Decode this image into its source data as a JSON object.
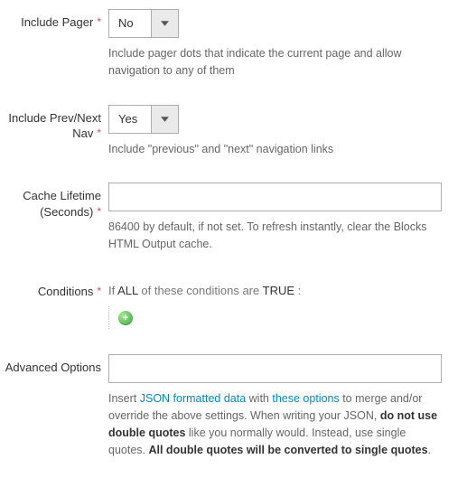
{
  "fields": {
    "includePager": {
      "label": "Include Pager",
      "value": "No",
      "note": "Include pager dots that indicate the current page and allow navigation to any of them"
    },
    "includePrevNext": {
      "label": "Include Prev/Next Nav",
      "value": "Yes",
      "note": "Include \"previous\" and \"next\" navigation links"
    },
    "cacheLifetime": {
      "label": "Cache Lifetime (Seconds)",
      "value": "",
      "note": "86400 by default, if not set. To refresh instantly, clear the Blocks HTML Output cache."
    },
    "conditions": {
      "label": "Conditions",
      "text_if": "If",
      "text_all": "ALL",
      "text_mid": " of these conditions are",
      "text_true": "TRUE",
      "text_end": ":"
    },
    "advanced": {
      "label": "Advanced Options",
      "value": "",
      "note_before": "Insert ",
      "note_link1": "JSON formatted data",
      "note_mid1": " with ",
      "note_link2": "these options",
      "note_mid2": " to merge and/or override the above settings. When writing your JSON, ",
      "note_bold1": "do not use double quotes",
      "note_mid3": " like you normally would. Instead, use single quotes. ",
      "note_bold2": "All double quotes will be converted to single quotes",
      "note_end": "."
    }
  }
}
